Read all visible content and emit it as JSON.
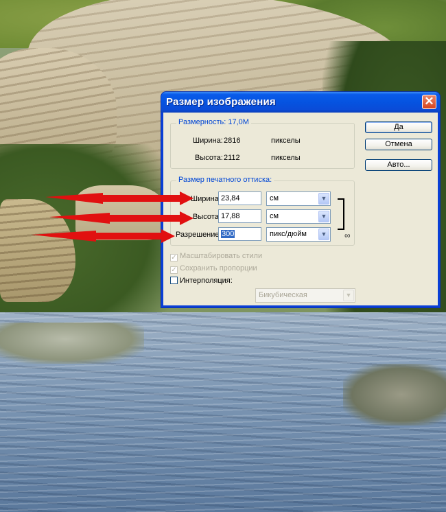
{
  "dialog": {
    "title": "Размер изображения",
    "close_glyph": "✕",
    "pixel_dimensions": {
      "title": "Размерность:  17,0M",
      "width_label": "Ширина:",
      "width_value": "2816",
      "width_unit": "пикселы",
      "height_label": "Высота:",
      "height_value": "2112",
      "height_unit": "пикселы"
    },
    "document_size": {
      "title": "Размер печатного оттиска:",
      "width_label": "Ширина:",
      "width_value": "23,84",
      "width_unit": "см",
      "height_label": "Высота:",
      "height_value": "17,88",
      "height_unit": "см",
      "resolution_label": "Разрешение:",
      "resolution_value": "300",
      "resolution_unit": "пикс/дюйм"
    },
    "options": {
      "scale_styles": "Масштабировать стили",
      "constrain_proportions": "Сохранить пропорции",
      "resample": "Интерполяция:",
      "resample_method": "Бикубическая"
    },
    "buttons": {
      "ok": "Да",
      "cancel": "Отмена",
      "auto": "Авто..."
    }
  },
  "colors": {
    "title_bar": "#0553e0",
    "group_title": "#0046d5",
    "arrow": "#e11010",
    "selection": "#316ac5"
  }
}
